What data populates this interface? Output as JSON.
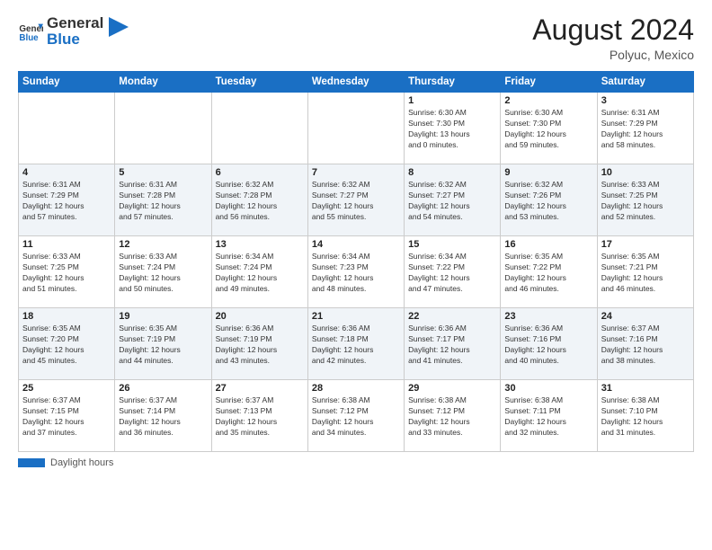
{
  "header": {
    "logo_general": "General",
    "logo_blue": "Blue",
    "month_year": "August 2024",
    "location": "Polyuc, Mexico"
  },
  "days_of_week": [
    "Sunday",
    "Monday",
    "Tuesday",
    "Wednesday",
    "Thursday",
    "Friday",
    "Saturday"
  ],
  "weeks": [
    [
      {
        "day": "",
        "info": ""
      },
      {
        "day": "",
        "info": ""
      },
      {
        "day": "",
        "info": ""
      },
      {
        "day": "",
        "info": ""
      },
      {
        "day": "1",
        "info": "Sunrise: 6:30 AM\nSunset: 7:30 PM\nDaylight: 13 hours\nand 0 minutes."
      },
      {
        "day": "2",
        "info": "Sunrise: 6:30 AM\nSunset: 7:30 PM\nDaylight: 12 hours\nand 59 minutes."
      },
      {
        "day": "3",
        "info": "Sunrise: 6:31 AM\nSunset: 7:29 PM\nDaylight: 12 hours\nand 58 minutes."
      }
    ],
    [
      {
        "day": "4",
        "info": "Sunrise: 6:31 AM\nSunset: 7:29 PM\nDaylight: 12 hours\nand 57 minutes."
      },
      {
        "day": "5",
        "info": "Sunrise: 6:31 AM\nSunset: 7:28 PM\nDaylight: 12 hours\nand 57 minutes."
      },
      {
        "day": "6",
        "info": "Sunrise: 6:32 AM\nSunset: 7:28 PM\nDaylight: 12 hours\nand 56 minutes."
      },
      {
        "day": "7",
        "info": "Sunrise: 6:32 AM\nSunset: 7:27 PM\nDaylight: 12 hours\nand 55 minutes."
      },
      {
        "day": "8",
        "info": "Sunrise: 6:32 AM\nSunset: 7:27 PM\nDaylight: 12 hours\nand 54 minutes."
      },
      {
        "day": "9",
        "info": "Sunrise: 6:32 AM\nSunset: 7:26 PM\nDaylight: 12 hours\nand 53 minutes."
      },
      {
        "day": "10",
        "info": "Sunrise: 6:33 AM\nSunset: 7:25 PM\nDaylight: 12 hours\nand 52 minutes."
      }
    ],
    [
      {
        "day": "11",
        "info": "Sunrise: 6:33 AM\nSunset: 7:25 PM\nDaylight: 12 hours\nand 51 minutes."
      },
      {
        "day": "12",
        "info": "Sunrise: 6:33 AM\nSunset: 7:24 PM\nDaylight: 12 hours\nand 50 minutes."
      },
      {
        "day": "13",
        "info": "Sunrise: 6:34 AM\nSunset: 7:24 PM\nDaylight: 12 hours\nand 49 minutes."
      },
      {
        "day": "14",
        "info": "Sunrise: 6:34 AM\nSunset: 7:23 PM\nDaylight: 12 hours\nand 48 minutes."
      },
      {
        "day": "15",
        "info": "Sunrise: 6:34 AM\nSunset: 7:22 PM\nDaylight: 12 hours\nand 47 minutes."
      },
      {
        "day": "16",
        "info": "Sunrise: 6:35 AM\nSunset: 7:22 PM\nDaylight: 12 hours\nand 46 minutes."
      },
      {
        "day": "17",
        "info": "Sunrise: 6:35 AM\nSunset: 7:21 PM\nDaylight: 12 hours\nand 46 minutes."
      }
    ],
    [
      {
        "day": "18",
        "info": "Sunrise: 6:35 AM\nSunset: 7:20 PM\nDaylight: 12 hours\nand 45 minutes."
      },
      {
        "day": "19",
        "info": "Sunrise: 6:35 AM\nSunset: 7:19 PM\nDaylight: 12 hours\nand 44 minutes."
      },
      {
        "day": "20",
        "info": "Sunrise: 6:36 AM\nSunset: 7:19 PM\nDaylight: 12 hours\nand 43 minutes."
      },
      {
        "day": "21",
        "info": "Sunrise: 6:36 AM\nSunset: 7:18 PM\nDaylight: 12 hours\nand 42 minutes."
      },
      {
        "day": "22",
        "info": "Sunrise: 6:36 AM\nSunset: 7:17 PM\nDaylight: 12 hours\nand 41 minutes."
      },
      {
        "day": "23",
        "info": "Sunrise: 6:36 AM\nSunset: 7:16 PM\nDaylight: 12 hours\nand 40 minutes."
      },
      {
        "day": "24",
        "info": "Sunrise: 6:37 AM\nSunset: 7:16 PM\nDaylight: 12 hours\nand 38 minutes."
      }
    ],
    [
      {
        "day": "25",
        "info": "Sunrise: 6:37 AM\nSunset: 7:15 PM\nDaylight: 12 hours\nand 37 minutes."
      },
      {
        "day": "26",
        "info": "Sunrise: 6:37 AM\nSunset: 7:14 PM\nDaylight: 12 hours\nand 36 minutes."
      },
      {
        "day": "27",
        "info": "Sunrise: 6:37 AM\nSunset: 7:13 PM\nDaylight: 12 hours\nand 35 minutes."
      },
      {
        "day": "28",
        "info": "Sunrise: 6:38 AM\nSunset: 7:12 PM\nDaylight: 12 hours\nand 34 minutes."
      },
      {
        "day": "29",
        "info": "Sunrise: 6:38 AM\nSunset: 7:12 PM\nDaylight: 12 hours\nand 33 minutes."
      },
      {
        "day": "30",
        "info": "Sunrise: 6:38 AM\nSunset: 7:11 PM\nDaylight: 12 hours\nand 32 minutes."
      },
      {
        "day": "31",
        "info": "Sunrise: 6:38 AM\nSunset: 7:10 PM\nDaylight: 12 hours\nand 31 minutes."
      }
    ]
  ],
  "footer": {
    "label": "Daylight hours"
  }
}
